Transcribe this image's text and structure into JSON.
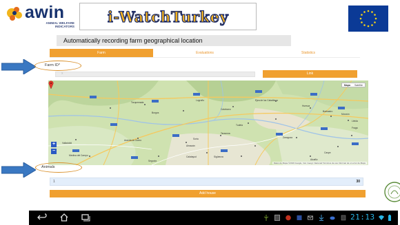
{
  "header": {
    "logo": {
      "word": "awin",
      "subtitle_lines": [
        "ANIMAL WELFARE",
        "INDICATORS"
      ]
    },
    "banner_title": "i-WatchTurkey"
  },
  "page": {
    "title": "Automatically recording farm geographical location"
  },
  "tabs": [
    {
      "label": "Farm",
      "active": true
    },
    {
      "label": "Evaluations",
      "active": false
    },
    {
      "label": "Statistics",
      "active": false
    }
  ],
  "farm": {
    "label": "Farm ID*",
    "input_clear_glyph": "x",
    "link_button": "Link"
  },
  "map": {
    "mode_options": [
      "Mapa",
      "Satélite"
    ],
    "active_mode": "Mapa",
    "zoom_in": "+",
    "zoom_out": "−",
    "attribution": "Datos de Mapa ©2016 Google, Inst. Geogr. Nacional   Términos de uso   Informar de un error de Maps",
    "place_labels": [
      "Torquemada",
      "Burgos",
      "Logroño",
      "Calahorra",
      "Tudela",
      "Ejea de los Caballeros",
      "Huesca",
      "Barbastro",
      "Monzón",
      "Zaragoza",
      "Soria",
      "Valladolid",
      "Aranda de Duero",
      "Almazán",
      "Calatayud",
      "Caspe",
      "Fraga",
      "Lleida",
      "Tarazona",
      "Medina del Campo",
      "Segovia",
      "Sigüenza",
      "Alcañiz"
    ]
  },
  "animals": {
    "label": "Animals",
    "field_placeholder": "1",
    "count": "30",
    "add_button": "Add house"
  },
  "system_bar": {
    "clock": "21:13"
  },
  "colors": {
    "accent": "#f0a030",
    "banner_text": "#f4b321",
    "annotation_arrow": "#3a78c2",
    "eu_blue": "#0b3a96",
    "clock": "#28b6e6"
  },
  "icons": {
    "back": "back-icon",
    "home": "home-icon",
    "recent": "recent-apps-icon",
    "pegman": "street-view-icon",
    "marker": "map-marker-icon"
  }
}
